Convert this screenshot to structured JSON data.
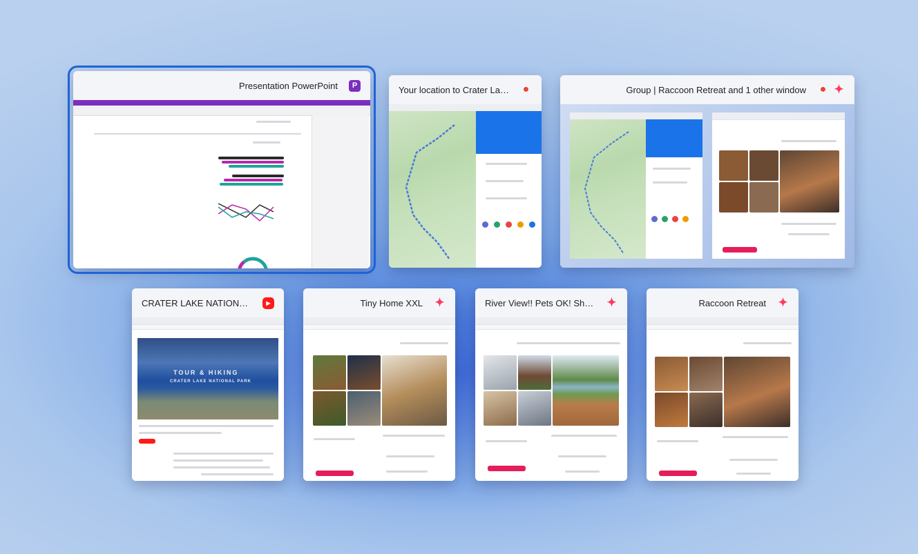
{
  "task_view": {
    "windows": [
      {
        "id": "ppt",
        "title": "Presentation PowerPoint",
        "icon": "powerpoint-icon",
        "selected": true
      },
      {
        "id": "maps",
        "title": "Your location to Crater Lake...",
        "icon": "google-maps-icon",
        "selected": false
      },
      {
        "id": "group",
        "title": "Group | Raccoon Retreat and 1 other window",
        "icon": "airbnb-icon",
        "selected": false
      },
      {
        "id": "youtube",
        "title": "CRATER LAKE NATIONAL P...",
        "icon": "youtube-icon",
        "selected": false
      },
      {
        "id": "tiny",
        "title": "Tiny Home XXL",
        "icon": "airbnb-icon",
        "selected": false
      },
      {
        "id": "river",
        "title": "River View!! Pets OK! Short...",
        "icon": "airbnb-icon",
        "selected": false
      },
      {
        "id": "raccoon",
        "title": "Raccoon Retreat",
        "icon": "airbnb-icon",
        "selected": false
      }
    ],
    "thumbnail_text": {
      "youtube_hero": "TOUR & HIKING",
      "youtube_sub": "CRATER LAKE NATIONAL PARK"
    },
    "colors": {
      "accent": "#1f63d6",
      "powerpoint": "#7b2fbf",
      "airbnb": "#ff385c",
      "youtube": "#ff1a1a",
      "maps_blue": "#1a73e8"
    }
  }
}
